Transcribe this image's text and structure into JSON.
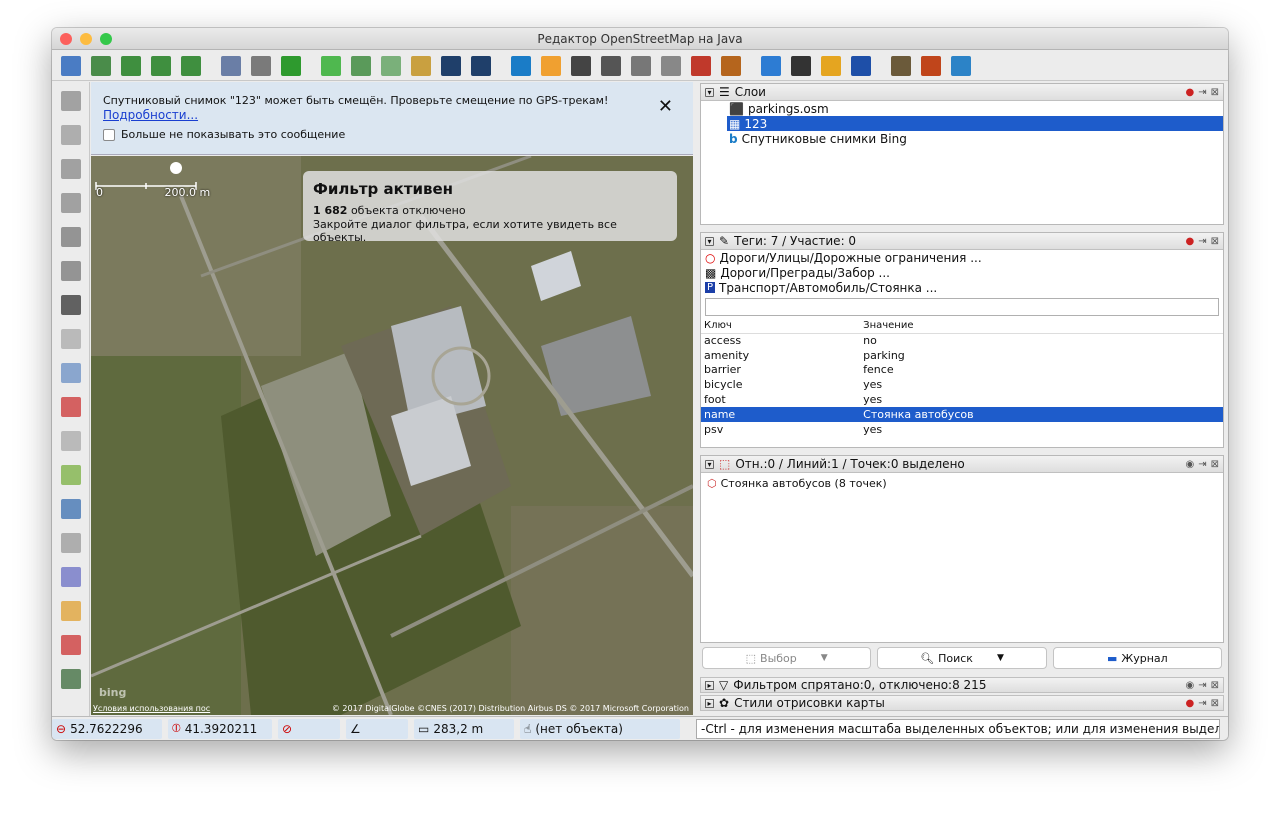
{
  "window": {
    "title": "Редактор OpenStreetMap на Java"
  },
  "toolbar": {
    "icons": [
      "open-file-icon",
      "open-location-icon",
      "download-icon",
      "download-along-icon",
      "upload-icon",
      "preferences-icon",
      "undo-icon",
      "redo-icon",
      "zoom-to-data-icon",
      "select-all-icon",
      "wms-tms-icon",
      "search-icon",
      "path-icon",
      "road-icon",
      "bing-icon",
      "traffic-light-icon",
      "parking-icon",
      "fence-icon",
      "wall-icon",
      "vending-icon",
      "brick-wall-icon",
      "railway-icon",
      "bed-icon",
      "football-icon",
      "beer-icon",
      "atm-icon",
      "industry-icon",
      "peak-icon",
      "waterway-icon"
    ]
  },
  "left_tools": [
    "select-icon",
    "draw-line-icon",
    "draw-nodes-icon",
    "improve-way-icon",
    "pencil-icon",
    "area-icon",
    "more-tools-icon",
    "toggle-layers-icon",
    "tags-icon",
    "selection-list-icon",
    "relation-icon",
    "validation-icon",
    "conflict-icon",
    "filter-icon",
    "map-style-icon",
    "notes-icon",
    "changesets-icon",
    "history-icon"
  ],
  "notice": {
    "message": "Спутниковый снимок \"123\" может быть смещён. Проверьте смещение по GPS-трекам!",
    "link": "Подробности...",
    "checkbox_label": "Больше не показывать это сообщение",
    "close": "✕"
  },
  "map": {
    "scale_zero": "0",
    "scale_label": "200.0 m",
    "filter_title": "Фильтр активен",
    "filter_count": "1 682",
    "filter_count_suffix": " объекта отключено",
    "filter_hint": "Закройте диалог фильтра, если хотите увидеть все объекты.",
    "terms_link": "Условия использования пос",
    "copyright": "© 2017 DigitalGlobe ©CNES (2017) Distribution Airbus DS © 2017 Microsoft Corporation",
    "bing_watermark": "bing"
  },
  "layers_panel": {
    "title": "Слои",
    "rows": [
      {
        "name": "parkings.osm",
        "icon": "osm-file-icon",
        "selected": false
      },
      {
        "name": "123",
        "icon": "imagery-layer-icon",
        "selected": true
      },
      {
        "name": "Спутниковые снимки Bing",
        "icon": "bing-icon",
        "selected": false
      }
    ]
  },
  "tags_panel": {
    "title": "Теги: 7 / Участие: 0",
    "presets": [
      {
        "text": "Дороги/Улицы/Дорожные ограничения ...",
        "icon": "restriction-icon"
      },
      {
        "text": "Дороги/Преграды/Забор ...",
        "icon": "fence-icon"
      },
      {
        "text": "Транспорт/Автомобиль/Стоянка ...",
        "icon": "parking-icon"
      }
    ],
    "columns": {
      "key": "Ключ",
      "value": "Значение"
    },
    "rows": [
      {
        "key": "access",
        "value": "no"
      },
      {
        "key": "amenity",
        "value": "parking"
      },
      {
        "key": "barrier",
        "value": "fence"
      },
      {
        "key": "bicycle",
        "value": "yes"
      },
      {
        "key": "foot",
        "value": "yes"
      },
      {
        "key": "name",
        "value": "Стоянка автобусов",
        "selected": true
      },
      {
        "key": "psv",
        "value": "yes"
      }
    ]
  },
  "selection_panel": {
    "title": "Отн.:0 / Линий:1 / Точек:0 выделено",
    "item": "Стоянка автобусов (8 точек)",
    "buttons": {
      "select": "Выбор",
      "search": "Поиск",
      "history": "Журнал"
    }
  },
  "filter_panel": {
    "title": "Фильтром спрятано:0, отключено:8 215"
  },
  "styles_panel": {
    "title": "Стили отрисовки карты"
  },
  "status": {
    "lat": "52.7622296",
    "lon": "41.3920211",
    "heading": "",
    "angle": "",
    "distance": "283,2 m",
    "object": "(нет объекта)",
    "hint": "-Ctrl - для изменения масштаба выделенных объектов; или для изменения выделения"
  },
  "colors": {
    "selection": "#1e5ccb",
    "notice_bg": "#dbe6f1",
    "status_bg": "#d9e5f2"
  }
}
